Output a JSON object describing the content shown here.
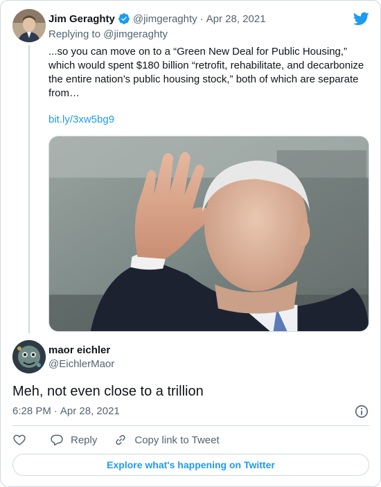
{
  "colors": {
    "accent": "#1d9bf0",
    "verified": "#1d9bf0",
    "secondary_text": "#536471",
    "border": "#cfd9de"
  },
  "parent_tweet": {
    "display_name": "Jim Geraghty",
    "handle": "@jimgeraghty",
    "separator": "·",
    "date": "Apr 28, 2021",
    "replying_prefix": "Replying to",
    "replying_to": "@jimgeraghty",
    "text": "...so you can move on to a “Green New Deal for Public Housing,” which would spent $180 billion “retrofit, rehabilitate, and decarbonize the entire nation’s public housing stock,” both of which are separate from…",
    "link": "bit.ly/3xw5bg9",
    "icons": [
      "verified-badge-icon",
      "twitter-bird-icon"
    ],
    "media": {
      "description_icon": "photo-icon"
    }
  },
  "reply_tweet": {
    "display_name": "maor eichler",
    "handle": "@EichlerMaor",
    "text": "Meh, not even close to a trillion",
    "time": "6:28 PM",
    "separator": "·",
    "date": "Apr 28, 2021"
  },
  "actions": {
    "like_icon": "heart-icon",
    "reply_label": "Reply",
    "copy_link_label": "Copy link to Tweet"
  },
  "explore_button": {
    "label": "Explore what's happening on Twitter"
  }
}
